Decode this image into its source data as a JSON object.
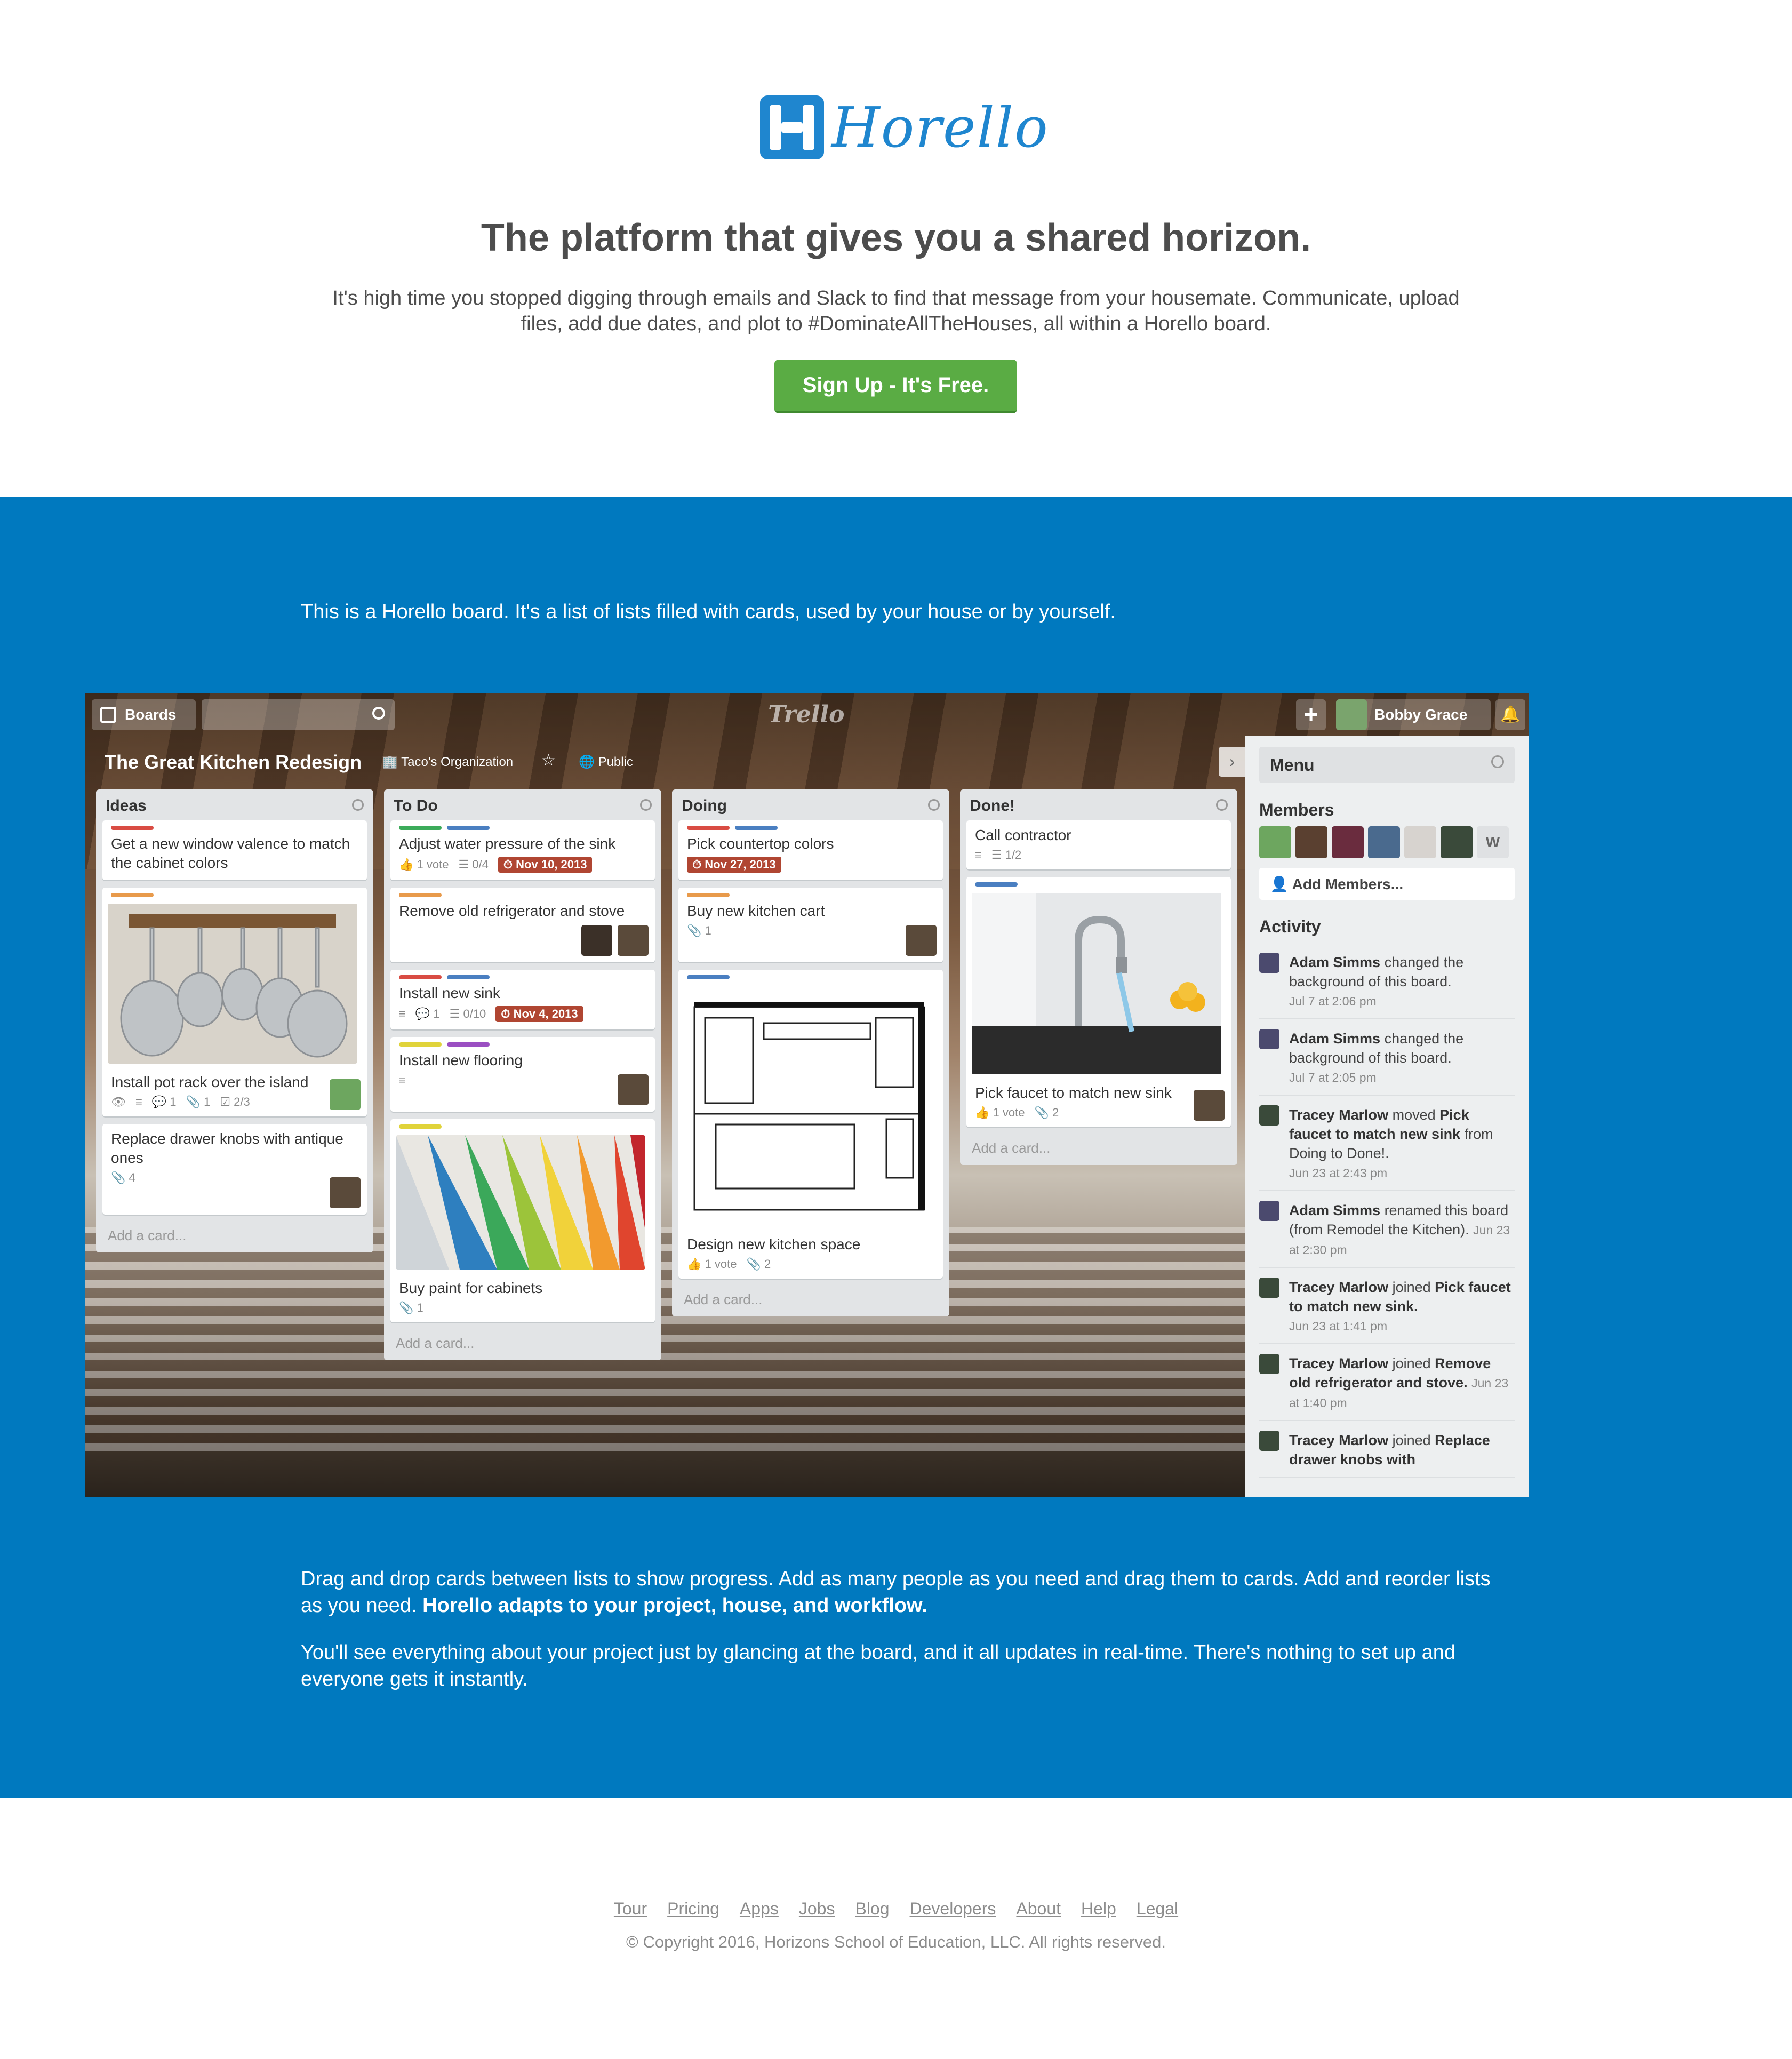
{
  "brand": {
    "name": "Horello",
    "color": "#1f86cf"
  },
  "hero": {
    "headline": "The platform that gives you a shared horizon.",
    "lead": "It's high time you stopped digging through emails and Slack to find that message from your housemate. Communicate, upload files, add due dates, and plot to #DominateAllTheHouses, all within a Horello board.",
    "cta": "Sign Up - It's Free."
  },
  "intro": "This is a Horello board. It's a list of lists filled with cards, used by your house or by yourself.",
  "board": {
    "header": {
      "boards_label": "Boards",
      "logo": "Trello",
      "user": "Bobby Grace",
      "plus": "+",
      "bell": "bell-icon"
    },
    "title": "The Great Kitchen Redesign",
    "org": "Taco's Organization",
    "visibility": "Public",
    "add_card": "Add a card...",
    "lists": {
      "ideas": {
        "title": "Ideas",
        "cards": [
          {
            "text": "Get a new window valence to match the cabinet colors"
          },
          {
            "text": "Install pot rack over the island",
            "badges": "2/3",
            "comments": "1",
            "attach": "1"
          },
          {
            "text": "Replace drawer knobs with antique ones",
            "attach": "4"
          }
        ]
      },
      "todo": {
        "title": "To Do",
        "cards": [
          {
            "text": "Adjust water pressure of the sink",
            "votes": "1 vote",
            "check": "0/4",
            "due": "Nov 10, 2013"
          },
          {
            "text": "Remove old refrigerator and stove"
          },
          {
            "text": "Install new sink",
            "comments": "1",
            "check": "0/10",
            "due": "Nov 4, 2013"
          },
          {
            "text": "Install new flooring"
          },
          {
            "text": "Buy paint for cabinets",
            "attach": "1"
          }
        ]
      },
      "doing": {
        "title": "Doing",
        "cards": [
          {
            "text": "Pick countertop colors",
            "due": "Nov 27, 2013"
          },
          {
            "text": "Buy new kitchen cart",
            "attach": "1"
          },
          {
            "text": "Design new kitchen space",
            "votes": "1 vote",
            "attach": "2"
          }
        ]
      },
      "done": {
        "title": "Done!",
        "cards": [
          {
            "text": "Call contractor",
            "check": "1/2"
          },
          {
            "text": "Pick faucet to match new sink",
            "votes": "1 vote",
            "attach": "2"
          }
        ]
      }
    },
    "menu": {
      "title": "Menu",
      "members_label": "Members",
      "members_extra": "W",
      "add_members": "Add Members...",
      "activity_label": "Activity",
      "activity": [
        {
          "who": "Adam Simms",
          "what": " changed the background of this board.",
          "when": "Jul 7 at 2:06 pm"
        },
        {
          "who": "Adam Simms",
          "what": " changed the background of this board.",
          "when": "Jul 7 at 2:05 pm"
        },
        {
          "who": "Tracey Marlow",
          "what": " moved ",
          "obj": "Pick faucet to match new sink",
          "what2": " from Doing to Done!.",
          "when": "Jun 23 at 2:43 pm"
        },
        {
          "who": "Adam Simms",
          "what": " renamed this board (from Remodel the Kitchen).",
          "when": "Jun 23 at 2:30 pm"
        },
        {
          "who": "Tracey Marlow",
          "what": " joined ",
          "obj": "Pick faucet to match new sink.",
          "when": "Jun 23 at 1:41 pm"
        },
        {
          "who": "Tracey Marlow",
          "what": " joined ",
          "obj": "Remove old refrigerator and stove.",
          "when": "Jun 23 at 1:40 pm"
        },
        {
          "who": "Tracey Marlow",
          "what": " joined ",
          "obj": "Replace drawer knobs with"
        }
      ]
    }
  },
  "body": {
    "para1": "Drag and drop cards between lists to show progress. Add as many people as you need and drag them to cards. Add and reorder lists as you need. ",
    "para1_bold": "Horello adapts to your project, house, and workflow.",
    "para2": "You'll see everything about your project just by glancing at the board, and it all updates in real-time. There's nothing to set up and everyone gets it instantly."
  },
  "footer": {
    "links": [
      "Tour",
      "Pricing",
      "Apps",
      "Jobs",
      "Blog",
      "Developers",
      "About",
      "Help",
      "Legal"
    ],
    "copyright": "© Copyright 2016, Horizons School of Education, LLC. All rights reserved."
  }
}
